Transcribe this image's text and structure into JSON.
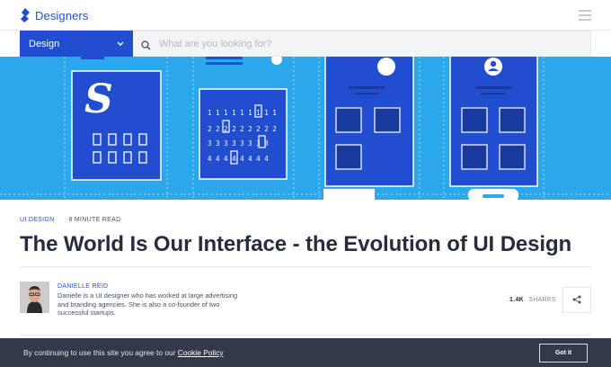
{
  "header": {
    "brand": "Designers",
    "menu_icon": "hamburger-icon",
    "logo_icon": "toptal-logo-icon"
  },
  "search": {
    "category": "Design",
    "placeholder": "What are you looking for?",
    "value": "",
    "icon": "search-icon"
  },
  "hero": {
    "icon_letter": "S",
    "number_rows": [
      "1 1 1 1 1 1 1 1 1",
      "2 2 2 2 2 2 2 2 2",
      "3 3 3 3 3 3 3 3",
      "4 4 4 4 4 4 4 4"
    ],
    "bg_color": "#2ba7ec",
    "card_color": "#204ecf"
  },
  "article": {
    "category": "UI DESIGN",
    "read_time": "8 MINUTE READ",
    "title": "The World Is Our Interface - the Evolution of UI Design"
  },
  "author": {
    "name": "DANIELLE REID",
    "bio": "Danielle is a UI designer who has worked at large advertising and branding agencies. She is also a co-founder of two successful startups."
  },
  "shares": {
    "count": "1.4K",
    "label": "SHARES",
    "icon": "share-icon"
  },
  "cookie": {
    "text": "By continuing to use this site you agree to our ",
    "link": "Cookie Policy",
    "button": "Got it"
  },
  "colors": {
    "brand": "#204ecf",
    "text": "#262d3d",
    "hero": "#2ba7ec"
  }
}
